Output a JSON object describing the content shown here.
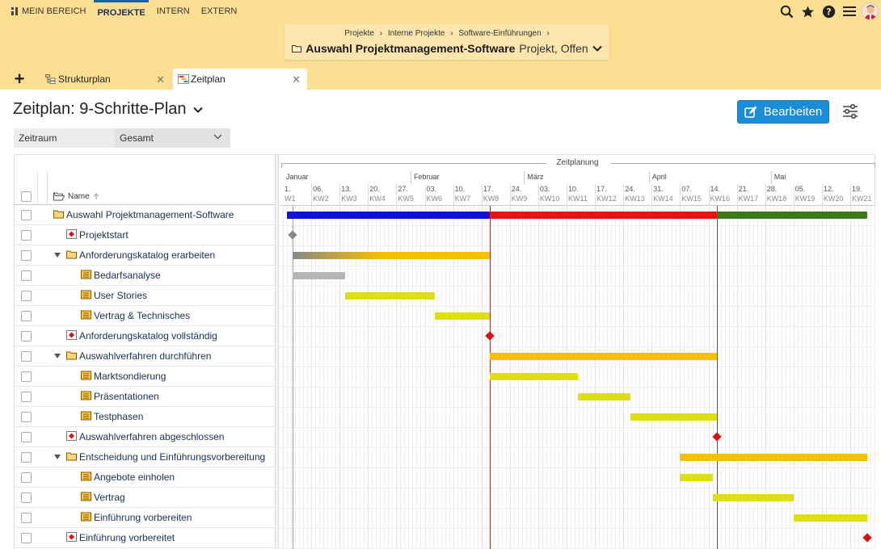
{
  "topnav": {
    "items": [
      {
        "label": "MEIN BEREICH",
        "active": false
      },
      {
        "label": "PROJEKTE",
        "active": true
      },
      {
        "label": "INTERN",
        "active": false
      },
      {
        "label": "EXTERN",
        "active": false
      }
    ]
  },
  "header_icons": [
    "search-icon",
    "star-icon",
    "help-icon",
    "menu-icon",
    "user-avatar"
  ],
  "breadcrumb": {
    "crumbs": [
      "Projekte",
      "Interne Projekte",
      "Software-Einführungen"
    ],
    "separator": "›",
    "project_name": "Auswahl Projektmanagement-Software",
    "project_state": "Projekt, Offen"
  },
  "tabs": [
    {
      "label": "Strukturplan",
      "active": false
    },
    {
      "label": "Zeitplan",
      "active": true
    }
  ],
  "page": {
    "title": "Zeitplan: 9-Schritte-Plan",
    "edit_label": "Bearbeiten"
  },
  "filter": {
    "label": "Zeitraum",
    "value": "Gesamt"
  },
  "table": {
    "name_header": "Name"
  },
  "gantt": {
    "title": "Zeitplanung",
    "months": [
      "Januar",
      "Februar",
      "März",
      "April",
      "Mai"
    ],
    "weeks": [
      {
        "d": "1.",
        "kw": "W1"
      },
      {
        "d": "06.",
        "kw": "KW2"
      },
      {
        "d": "13.",
        "kw": "KW3"
      },
      {
        "d": "20.",
        "kw": "KW4"
      },
      {
        "d": "27.",
        "kw": "KW5"
      },
      {
        "d": "03.",
        "kw": "KW6"
      },
      {
        "d": "10.",
        "kw": "KW7"
      },
      {
        "d": "17.",
        "kw": "KW8"
      },
      {
        "d": "24.",
        "kw": "KW9"
      },
      {
        "d": "03.",
        "kw": "KW10"
      },
      {
        "d": "10.",
        "kw": "KW11"
      },
      {
        "d": "17.",
        "kw": "KW12"
      },
      {
        "d": "24.",
        "kw": "KW13"
      },
      {
        "d": "31.",
        "kw": "KW14"
      },
      {
        "d": "07.",
        "kw": "KW15"
      },
      {
        "d": "14.",
        "kw": "KW16"
      },
      {
        "d": "21.",
        "kw": "KW17"
      },
      {
        "d": "28.",
        "kw": "KW18"
      },
      {
        "d": "05.",
        "kw": "KW19"
      },
      {
        "d": "12.",
        "kw": "KW20"
      },
      {
        "d": "19.",
        "kw": "KW21"
      }
    ],
    "colors": {
      "phase1": "#1010e0",
      "phase2": "#ee1111",
      "phase3": "#3a7a1a",
      "summary": "#f5c000",
      "task": "#dede10",
      "done": "#b5b5b5",
      "milestone": "#dd1111",
      "milestone_start": "#888888",
      "deadline": "#a33333"
    }
  },
  "rows": [
    {
      "label": "Auswahl Projektmanagement-Software",
      "type": "project",
      "level": 0
    },
    {
      "label": "Projektstart",
      "type": "milestone",
      "level": 1
    },
    {
      "label": "Anforderungskatalog erarbeiten",
      "type": "summary",
      "level": 1
    },
    {
      "label": "Bedarfsanalyse",
      "type": "task",
      "level": 2
    },
    {
      "label": "User Stories",
      "type": "task",
      "level": 2
    },
    {
      "label": "Vertrag & Technisches",
      "type": "task",
      "level": 2
    },
    {
      "label": "Anforderungskatalog vollständig",
      "type": "milestone",
      "level": 1
    },
    {
      "label": "Auswahlverfahren durchführen",
      "type": "summary",
      "level": 1
    },
    {
      "label": "Marktsondierung",
      "type": "task",
      "level": 2
    },
    {
      "label": "Präsentationen",
      "type": "task",
      "level": 2
    },
    {
      "label": "Testphasen",
      "type": "task",
      "level": 2
    },
    {
      "label": "Auswahlverfahren abgeschlossen",
      "type": "milestone",
      "level": 1
    },
    {
      "label": "Entscheidung und Einführungsvorbereitung",
      "type": "summary",
      "level": 1
    },
    {
      "label": "Angebote einholen",
      "type": "task",
      "level": 2
    },
    {
      "label": "Vertrag",
      "type": "task",
      "level": 2
    },
    {
      "label": "Einführung vorbereiten",
      "type": "task",
      "level": 2
    },
    {
      "label": "Einführung vorbereitet",
      "type": "milestone",
      "level": 1
    }
  ]
}
